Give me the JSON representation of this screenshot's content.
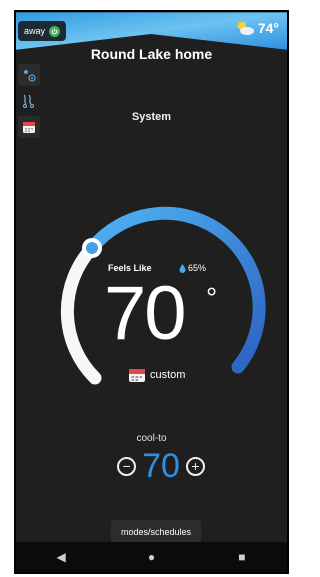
{
  "header": {
    "away_label": "away",
    "weather_temp": "74°",
    "weather_icon": "partly-sunny-icon",
    "home_name": "Round Lake home"
  },
  "sidebar": {
    "icons": [
      "fan-icon",
      "schedule-icon",
      "calendar-icon"
    ]
  },
  "main": {
    "system_label": "System",
    "feels_like_label": "Feels Like",
    "humidity": "65%",
    "current_temp": "70",
    "degree_symbol": "°",
    "schedule_label": "custom",
    "mode_label": "cool-to",
    "setpoint": "70",
    "dial_level": 0.0
  },
  "controls": {
    "minus_label": "−",
    "plus_label": "+"
  },
  "footer": {
    "modes_button": "modes/schedules"
  },
  "navbar": {
    "back": "◀",
    "home": "●",
    "recent": "■"
  },
  "colors": {
    "accent_blue": "#2f8fe0",
    "dial_start": "#4fb3f2",
    "dial_end": "#2d62c4",
    "away_green": "#43b35a"
  }
}
